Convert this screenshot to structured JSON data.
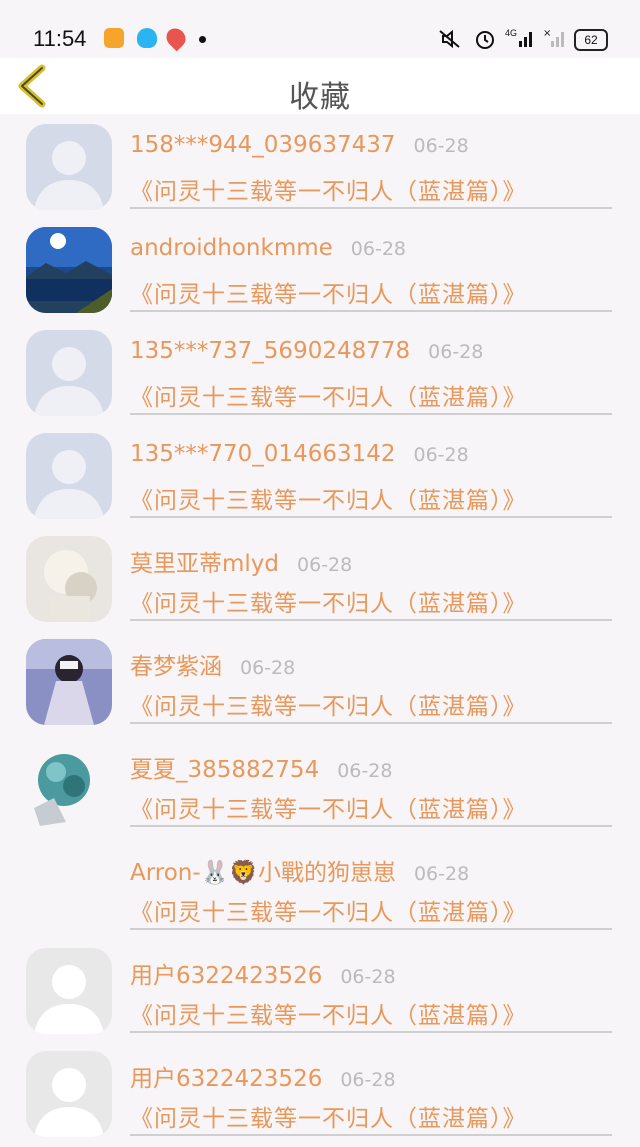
{
  "status_bar": {
    "time": "11:54",
    "battery": "62",
    "network": "4G"
  },
  "header": {
    "title": "收藏",
    "back_icon": "chevron-left-icon"
  },
  "items": [
    {
      "name": "158***944_039637437",
      "date": "06-28",
      "work": "《问灵十三载等一不归人（蓝湛篇）》",
      "avatar": "default-avatar"
    },
    {
      "name": "androidhonkmme",
      "date": "06-28",
      "work": "《问灵十三载等一不归人（蓝湛篇）》",
      "avatar": "lake-photo"
    },
    {
      "name": "135***737_5690248778",
      "date": "06-28",
      "work": "《问灵十三载等一不归人（蓝湛篇）》",
      "avatar": "default-avatar"
    },
    {
      "name": "135***770_014663142",
      "date": "06-28",
      "work": "《问灵十三载等一不归人（蓝湛篇）》",
      "avatar": "default-avatar"
    },
    {
      "name": "莫里亚蒂mlyd",
      "date": "06-28",
      "work": "《问灵十三载等一不归人（蓝湛篇）》",
      "avatar": "blurred-photo"
    },
    {
      "name": "春梦紫涵",
      "date": "06-28",
      "work": "《问灵十三载等一不归人（蓝湛篇）》",
      "avatar": "girl-photo"
    },
    {
      "name": "夏夏_385882754",
      "date": "06-28",
      "work": "《问灵十三载等一不归人（蓝湛篇）》",
      "avatar": "flower-photo"
    },
    {
      "name": "Arron-🐰🦁小戰的狗崽崽",
      "date": "06-28",
      "work": "《问灵十三载等一不归人（蓝湛篇）》",
      "avatar": "none"
    },
    {
      "name": "用户6322423526",
      "date": "06-28",
      "work": "《问灵十三载等一不归人（蓝湛篇）》",
      "avatar": "grey-default-avatar"
    },
    {
      "name": "用户6322423526",
      "date": "06-28",
      "work": "《问灵十三载等一不归人（蓝湛篇）》",
      "avatar": "grey-default-avatar"
    }
  ]
}
